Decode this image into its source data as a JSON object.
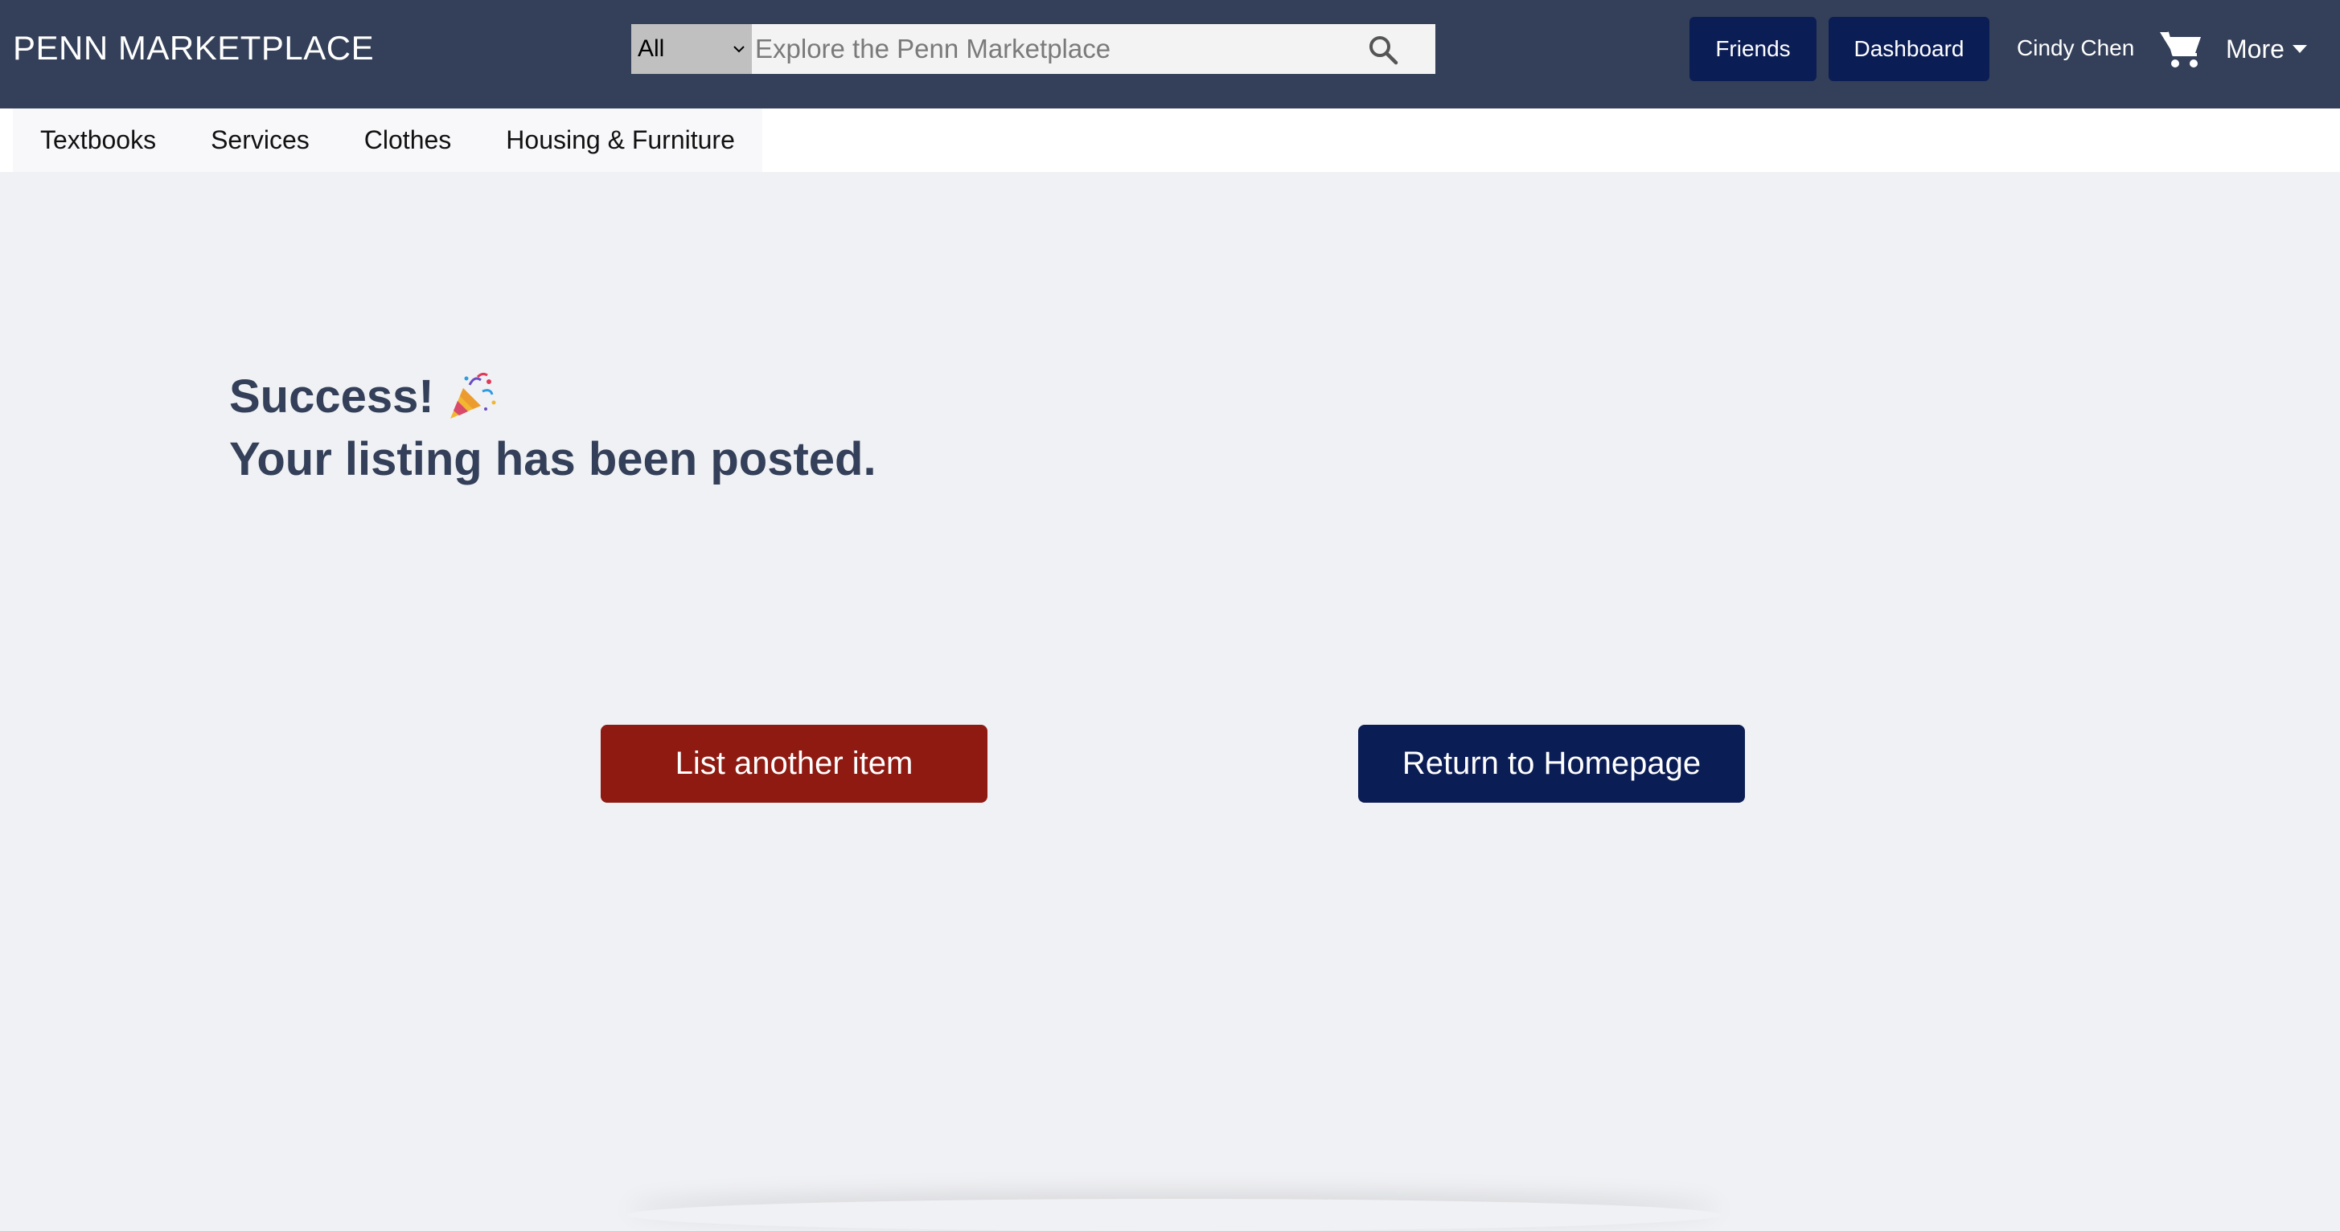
{
  "navbar": {
    "brand": "PENN MARKETPLACE",
    "search": {
      "category_selected": "All",
      "placeholder": "Explore the Penn Marketplace",
      "icon": "search-icon"
    },
    "friends_label": "Friends",
    "dashboard_label": "Dashboard",
    "user_name": "Cindy Chen",
    "cart_icon": "cart-icon",
    "more_label": "More"
  },
  "categories": [
    {
      "label": "Textbooks"
    },
    {
      "label": "Services"
    },
    {
      "label": "Clothes"
    },
    {
      "label": "Housing & Furniture"
    }
  ],
  "main": {
    "success_title": "Success!",
    "success_message": "Your listing has been posted.",
    "party_icon": "party-popper-icon",
    "list_another_label": "List another item",
    "return_home_label": "Return to Homepage"
  },
  "colors": {
    "navbar_bg": "#344059",
    "primary_button": "#0b1d55",
    "danger_button": "#8e1a12",
    "page_bg": "#f0f1f4",
    "heading_text": "#344059"
  }
}
